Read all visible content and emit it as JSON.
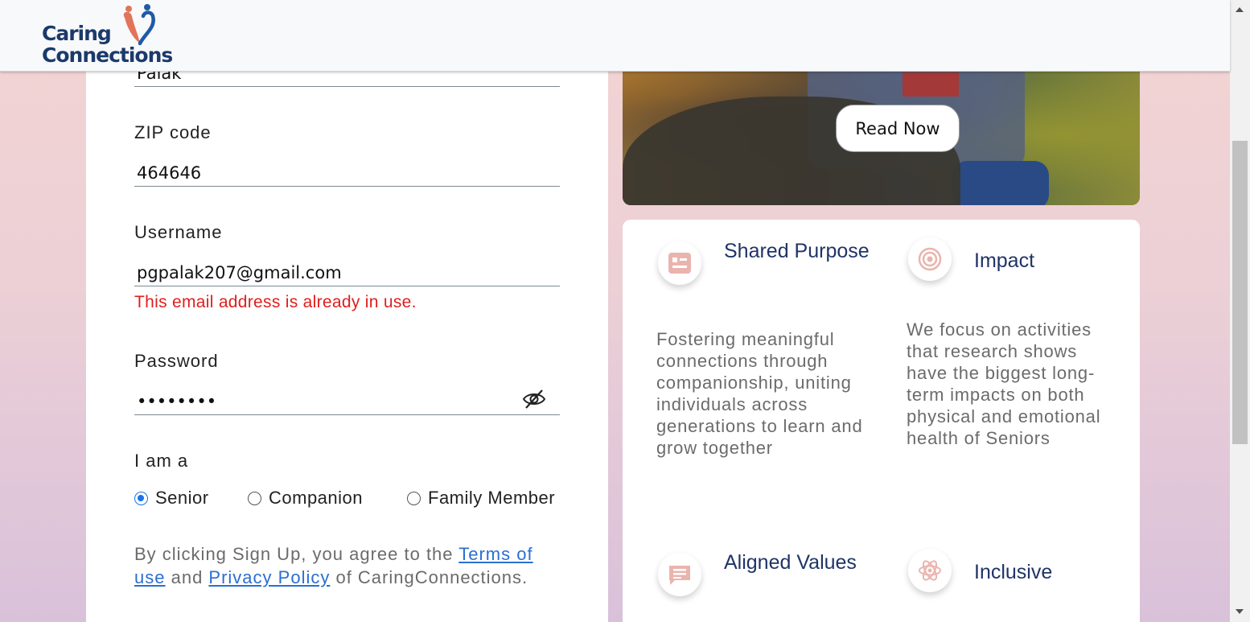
{
  "header": {
    "logo_line1": "Caring",
    "logo_line2": "Connections"
  },
  "form": {
    "name_value": "Palak",
    "zip_label": "ZIP code",
    "zip_value": "464646",
    "username_label": "Username",
    "username_value": "pgpalak207@gmail.com",
    "username_error": "This email address is already in use.",
    "password_label": "Password",
    "password_value": "••••••••",
    "role_label": "I am a",
    "role_options": [
      "Senior",
      "Companion",
      "Family Member"
    ],
    "role_selected": "Senior",
    "terms_prefix": "By clicking Sign Up, you agree to the ",
    "terms_link": "Terms of use",
    "terms_and": " and ",
    "privacy_link": "Privacy Policy",
    "terms_suffix": " of CaringConnections."
  },
  "hero": {
    "button_label": "Read Now"
  },
  "features": [
    {
      "title": "Shared Purpose",
      "icon": "id-card-icon",
      "description": "Fostering meaningful connections through companionship, uniting individuals across generations to learn and grow together"
    },
    {
      "title": "Impact",
      "icon": "target-icon",
      "description": "We focus on activities that research shows have the biggest long-term impacts on both physical and emotional health of Seniors"
    },
    {
      "title": "Aligned Values",
      "icon": "chat-icon",
      "description": ""
    },
    {
      "title": "Inclusive",
      "icon": "atom-icon",
      "description": ""
    }
  ],
  "colors": {
    "accent_icon": "#eab4ae",
    "title_navy": "#1f3466",
    "error_red": "#e01e1e",
    "link_blue": "#2a6fd1",
    "radio_blue": "#1a73e8"
  }
}
